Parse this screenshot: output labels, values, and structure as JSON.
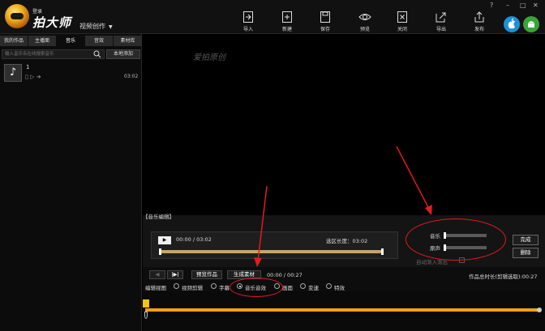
{
  "app": {
    "logo_small": "登录",
    "logo_main": "拍大师",
    "mode_menu": "视频创作"
  },
  "toolbar": {
    "import": "导入",
    "new": "新建",
    "save": "保存",
    "preview": "预览",
    "close": "关闭",
    "export": "导出",
    "publish": "发布"
  },
  "window_controls": {
    "help": "?",
    "minimize": "–",
    "maximize": "□",
    "close": "✕"
  },
  "left_panel": {
    "tabs": [
      "我的作品",
      "主播面",
      "音乐",
      "音效",
      "素材库"
    ],
    "active_tab": 2,
    "search_placeholder": "输入音乐名在线搜索音乐",
    "local_add": "本地添加",
    "music_items": [
      {
        "name": "1",
        "duration": "03:02"
      }
    ]
  },
  "preview": {
    "watermark": "爱拍原创"
  },
  "music_edit": {
    "section_label": "【音乐编辑】",
    "time_current": "00:00",
    "time_total": "03:02",
    "time_separator": "/",
    "selection_label": "选区长度：",
    "selection_value": "03:02",
    "music_volume_label": "音乐",
    "original_volume_label": "原声",
    "auto_fade_label": "自动渐入渐出",
    "done_button": "完成",
    "delete_button": "删除"
  },
  "timeline_toolbar": {
    "preview_button": "预览作品",
    "generate_button": "生成素材",
    "time": "00:00 / 00:27",
    "total_length": "作品总时长(剪辑选取):00:27",
    "view_label": "编辑视图",
    "views": [
      "视频剪辑",
      "字幕",
      "音乐音效",
      "画面",
      "变速",
      "特效"
    ],
    "selected_view": 2
  },
  "colors": {
    "accent_orange": "#f0a019",
    "annotation_red": "#e01c1c",
    "range_bar": "#c8a273"
  },
  "icons": [
    "import-icon",
    "new-icon",
    "save-icon",
    "preview-icon",
    "close-icon",
    "export-icon",
    "publish-icon",
    "apple-icon",
    "android-icon",
    "search-icon",
    "music-note-icon"
  ]
}
